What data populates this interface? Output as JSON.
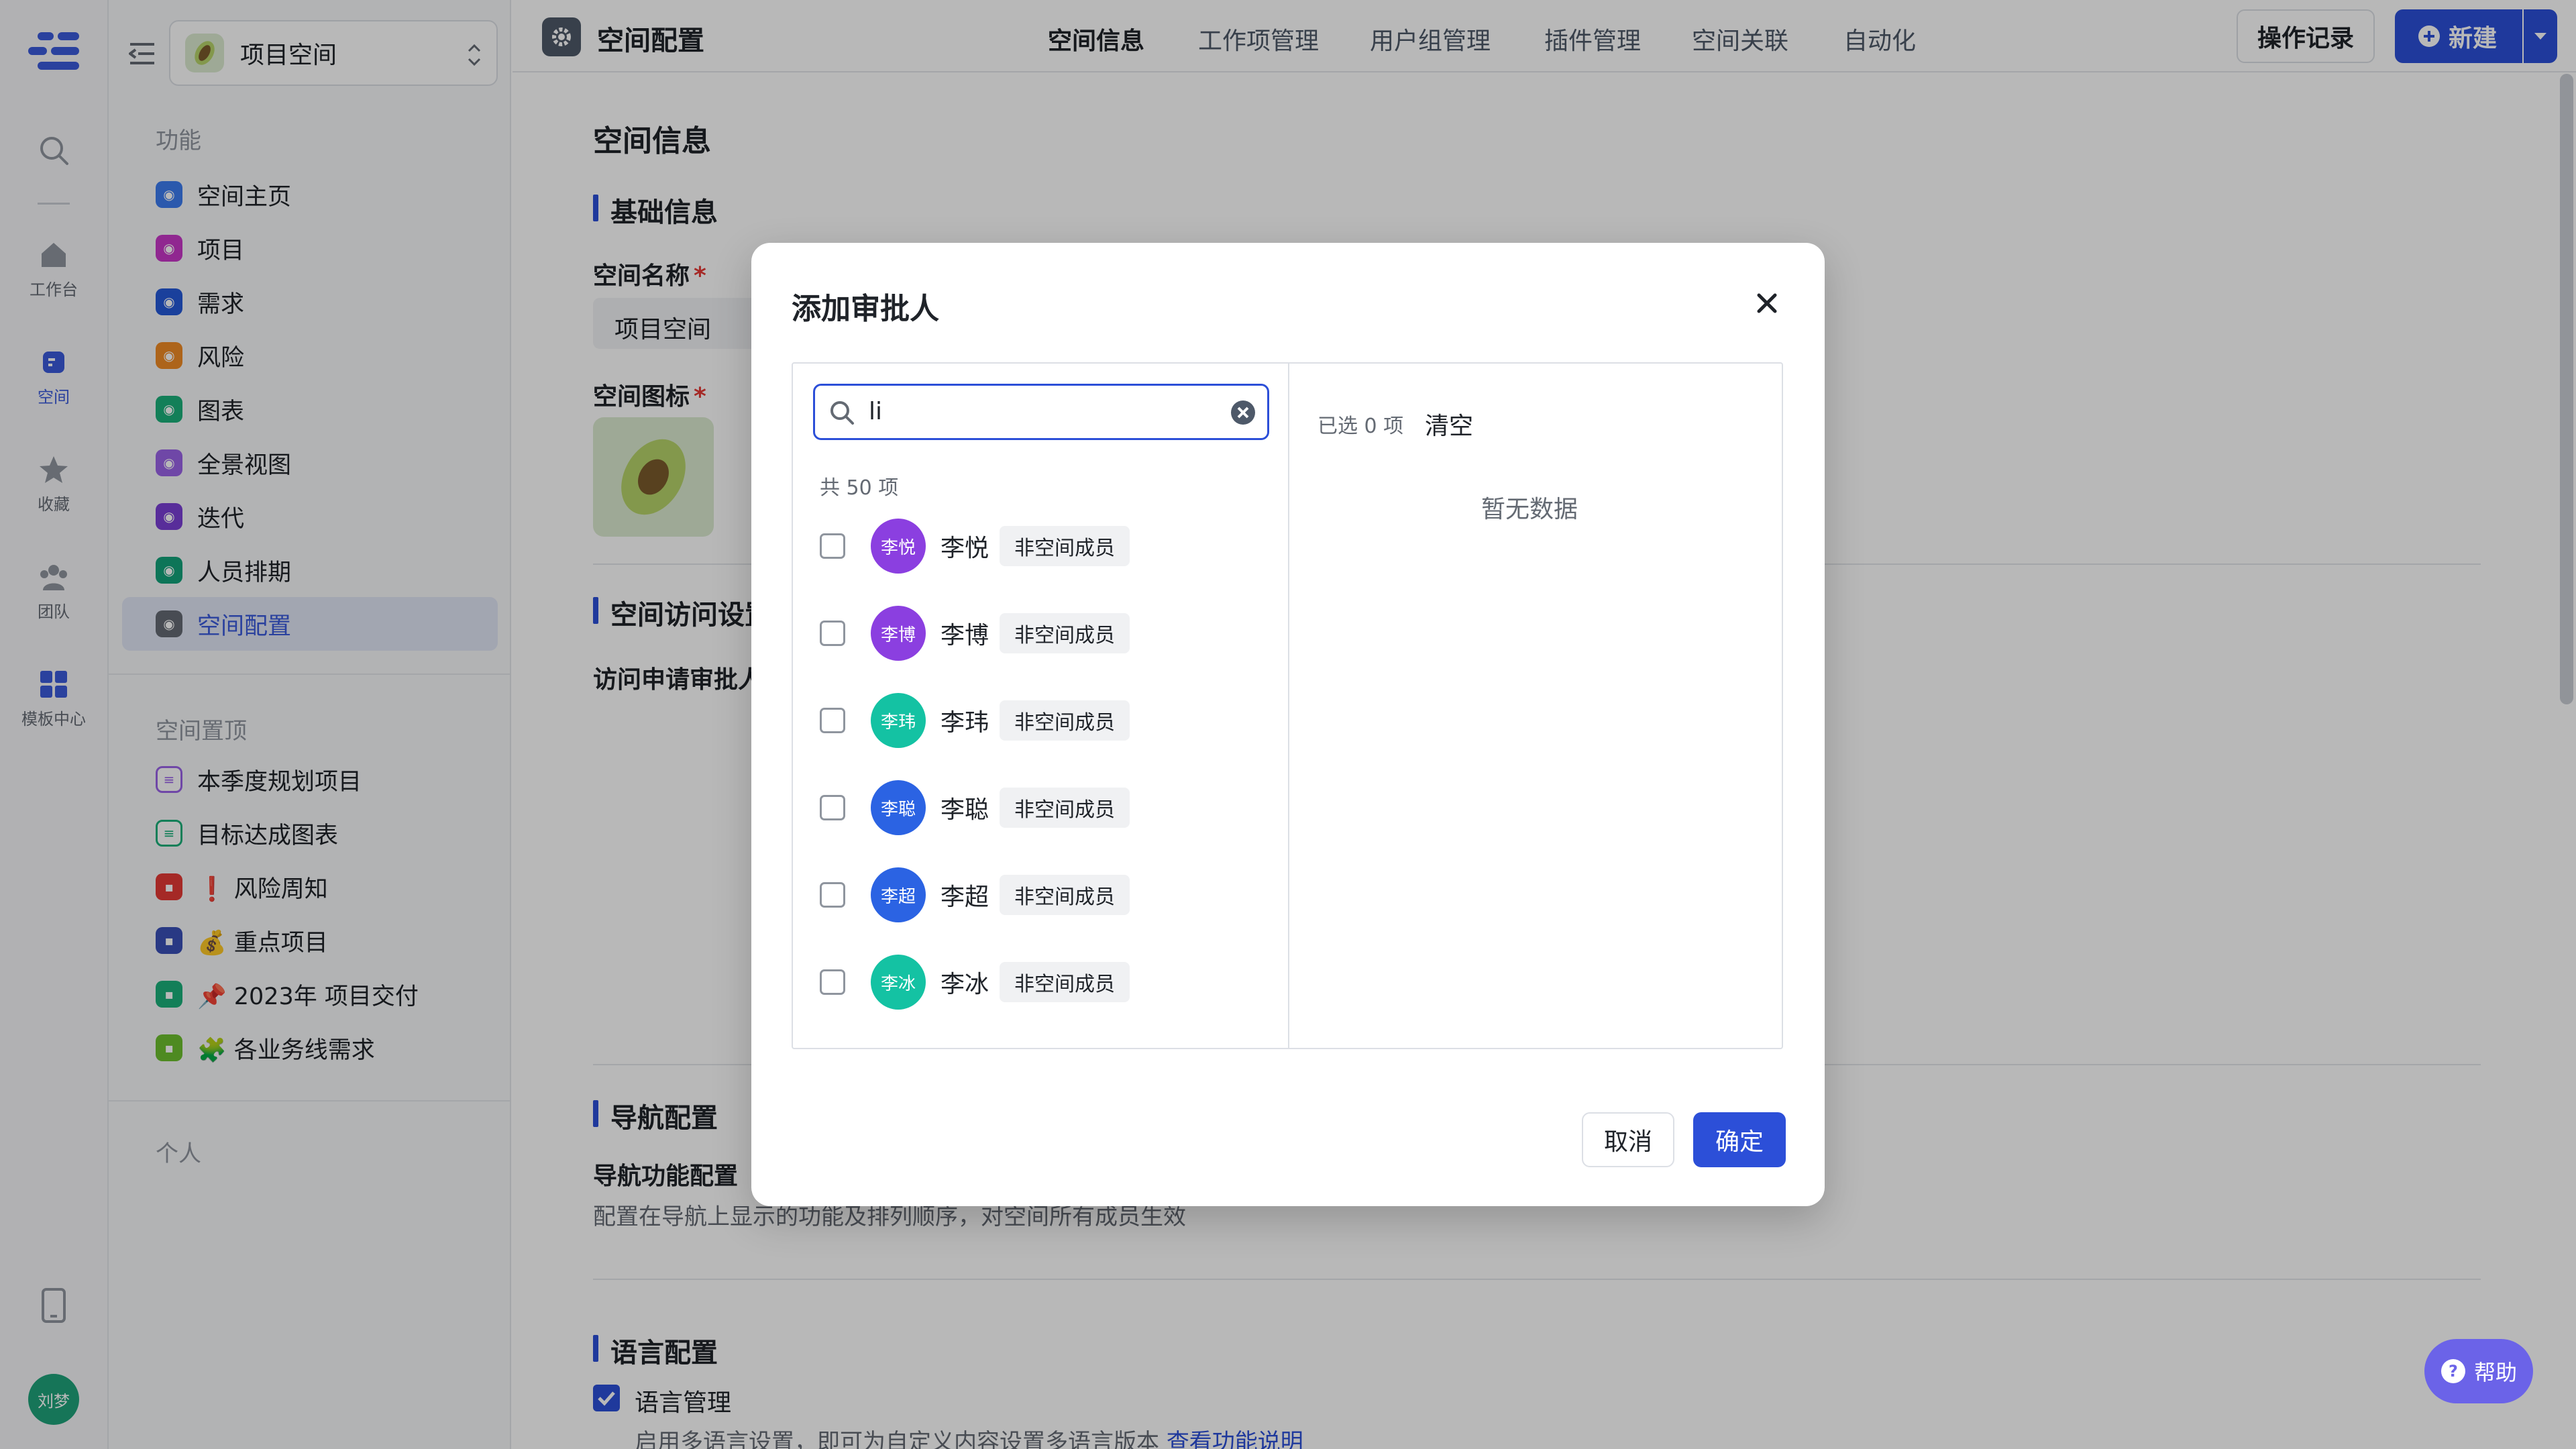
{
  "rail": {
    "items": [
      {
        "label": "工作台"
      },
      {
        "label": "空间"
      },
      {
        "label": "收藏"
      },
      {
        "label": "团队"
      },
      {
        "label": "模板中心"
      }
    ],
    "user_avatar": "刘梦"
  },
  "sidebar": {
    "workspace_name": "项目空间",
    "section_features": "功能",
    "features": [
      {
        "label": "空间主页",
        "color": "#3c7cf0"
      },
      {
        "label": "项目",
        "color": "#c837c8"
      },
      {
        "label": "需求",
        "color": "#2459d9"
      },
      {
        "label": "风险",
        "color": "#f08b25"
      },
      {
        "label": "图表",
        "color": "#1bb07a"
      },
      {
        "label": "全景视图",
        "color": "#9a63e8"
      },
      {
        "label": "迭代",
        "color": "#7a3fd6"
      },
      {
        "label": "人员排期",
        "color": "#12a37a"
      },
      {
        "label": "空间配置",
        "color": "#646a73"
      }
    ],
    "section_pinned": "空间置顶",
    "pinned": [
      {
        "label": "本季度规划项目",
        "color": "#9a63e8"
      },
      {
        "label": "目标达成图表",
        "color": "#1bb07a"
      },
      {
        "label": "❗ 风险周知",
        "color": "#e53935"
      },
      {
        "label": "💰 重点项目",
        "color": "#3a4fb8"
      },
      {
        "label": "📌 2023年 项目交付",
        "color": "#1bb07a"
      },
      {
        "label": "🧩 各业务线需求",
        "color": "#6cbf2f"
      }
    ],
    "section_personal": "个人"
  },
  "header": {
    "title": "空间配置",
    "tabs": [
      "空间信息",
      "工作项管理",
      "用户组管理",
      "插件管理",
      "空间关联",
      "自动化"
    ],
    "ops_log": "操作记录",
    "new_button": "新建"
  },
  "content": {
    "page_title": "空间信息",
    "basic_info": "基础信息",
    "space_name_label": "空间名称",
    "space_name_value": "项目空间",
    "space_icon_label": "空间图标",
    "access_section": "空间访问设置",
    "access_approver_label": "访问申请审批人",
    "nav_section": "导航配置",
    "nav_func_label": "导航功能配置",
    "nav_func_desc": "配置在导航上显示的功能及排列顺序，对空间所有成员生效",
    "lang_section": "语言配置",
    "lang_manage": "语言管理",
    "lang_desc": "启用多语言设置，即可为自定义内容设置多语言版本",
    "lang_link": "查看功能说明"
  },
  "modal": {
    "title": "添加审批人",
    "search_value": "li",
    "total": "共 50 项",
    "candidates": [
      {
        "name": "李悦",
        "avatar": "李悦",
        "tag": "非空间成员",
        "color": "#8b3fe0"
      },
      {
        "name": "李博",
        "avatar": "李博",
        "tag": "非空间成员",
        "color": "#8b3fe0"
      },
      {
        "name": "李玮",
        "avatar": "李玮",
        "tag": "非空间成员",
        "color": "#14c2a3"
      },
      {
        "name": "李聪",
        "avatar": "李聪",
        "tag": "非空间成员",
        "color": "#2b63e3"
      },
      {
        "name": "李超",
        "avatar": "李超",
        "tag": "非空间成员",
        "color": "#2b63e3"
      },
      {
        "name": "李冰",
        "avatar": "李冰",
        "tag": "非空间成员",
        "color": "#14c2a3"
      }
    ],
    "selected_count": "已选 0 项",
    "clear": "清空",
    "empty": "暂无数据",
    "cancel": "取消",
    "confirm": "确定"
  },
  "help": "帮助"
}
